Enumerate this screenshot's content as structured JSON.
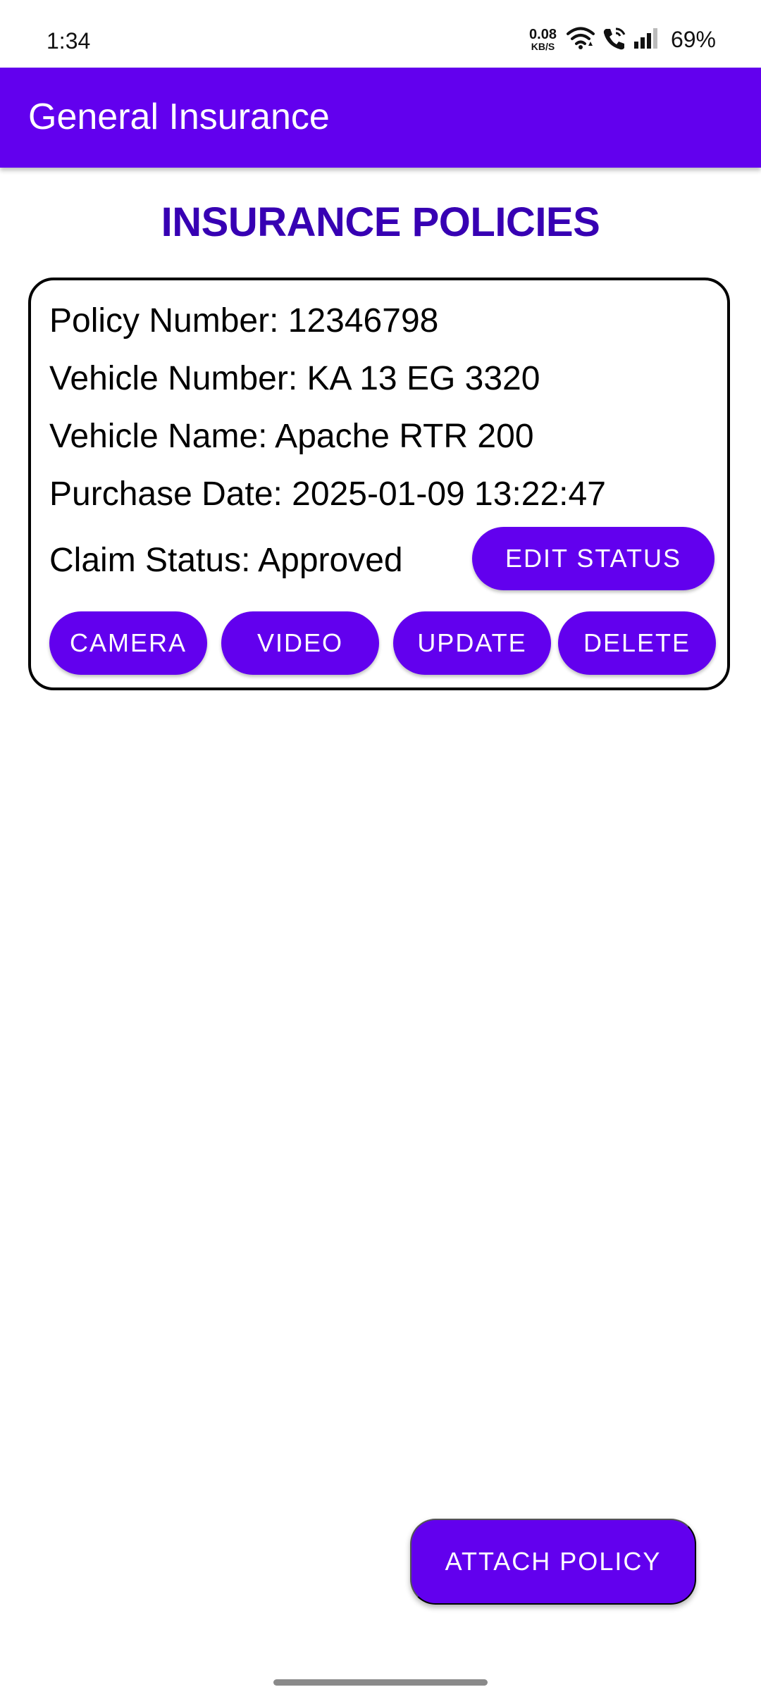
{
  "status_bar": {
    "time": "1:34",
    "net_speed_value": "0.08",
    "net_speed_unit": "KB/S",
    "battery": "69%",
    "icons": [
      "wifi-icon",
      "wifi-calling-icon",
      "signal-icon"
    ]
  },
  "app_bar": {
    "title": "General Insurance"
  },
  "page": {
    "heading": "INSURANCE POLICIES"
  },
  "policy_card": {
    "policy_number": "Policy Number: 12346798",
    "vehicle_number": "Vehicle Number: KA 13 EG 3320",
    "vehicle_name": "Vehicle Name: Apache RTR 200",
    "purchase_date": "Purchase Date: 2025-01-09 13:22:47",
    "claim_status": "Claim Status: Approved",
    "edit_status_label": "EDIT STATUS",
    "camera_label": "CAMERA",
    "video_label": "VIDEO",
    "update_label": "UPDATE",
    "delete_label": "DELETE"
  },
  "fab": {
    "label": "ATTACH POLICY"
  },
  "colors": {
    "primary": "#6200EE",
    "heading": "#3700B3",
    "on_primary": "#FFFFFF"
  }
}
